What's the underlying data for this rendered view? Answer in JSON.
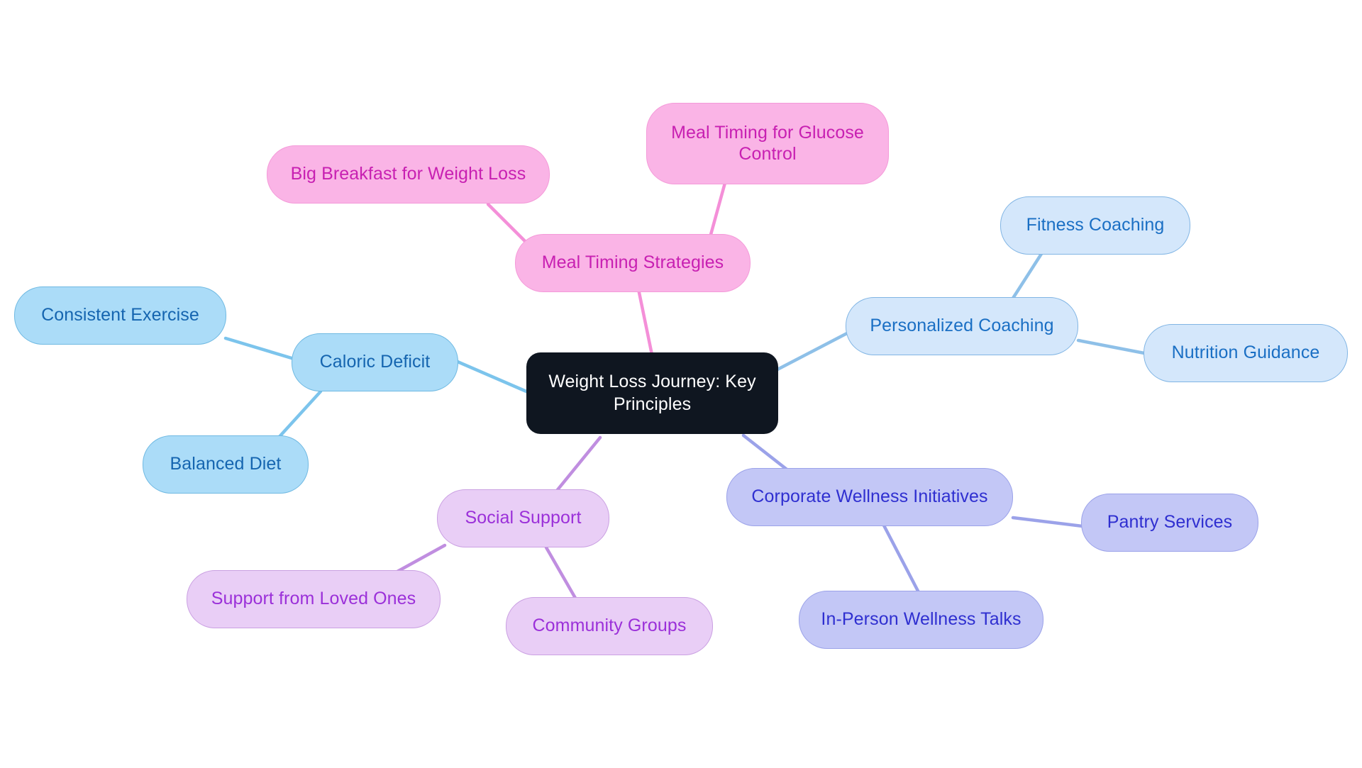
{
  "diagram": {
    "type": "mindmap",
    "background": "#ffffff",
    "root": {
      "id": "root",
      "label": "Weight Loss Journey: Key\nPrinciples",
      "fill": "#0f1620",
      "text_color": "#ffffff"
    },
    "palette": {
      "blue_fill": "#abdcf8",
      "blue_border": "#6fb9e2",
      "blue_text": "#1565b0",
      "paleblue_fill": "#d4e7fb",
      "paleblue_border": "#81b5e4",
      "paleblue_text": "#1a6fc4",
      "pink_fill": "#fab4e6",
      "pink_border": "#f49ad9",
      "pink_text": "#c820b2",
      "violet_fill": "#e9cef6",
      "violet_border": "#caa0e2",
      "violet_text": "#9b30d9",
      "periwinkle_fill": "#c3c7f6",
      "periwinkle_border": "#9ba2e9",
      "periwinkle_text": "#2f2fd0"
    },
    "branches": [
      {
        "id": "caloric-deficit",
        "label": "Caloric Deficit",
        "color_key": "blue",
        "children": [
          {
            "id": "consistent-exercise",
            "label": "Consistent Exercise"
          },
          {
            "id": "balanced-diet",
            "label": "Balanced Diet"
          }
        ]
      },
      {
        "id": "meal-timing-strategies",
        "label": "Meal Timing Strategies",
        "color_key": "pink",
        "children": [
          {
            "id": "big-breakfast-for-weight-loss",
            "label": "Big Breakfast for Weight Loss"
          },
          {
            "id": "meal-timing-for-glucose-control",
            "label": "Meal Timing for Glucose\nControl"
          }
        ]
      },
      {
        "id": "personalized-coaching",
        "label": "Personalized Coaching",
        "color_key": "paleblue",
        "children": [
          {
            "id": "fitness-coaching",
            "label": "Fitness Coaching"
          },
          {
            "id": "nutrition-guidance",
            "label": "Nutrition Guidance"
          }
        ]
      },
      {
        "id": "corporate-wellness-initiatives",
        "label": "Corporate Wellness Initiatives",
        "color_key": "periwinkle",
        "children": [
          {
            "id": "pantry-services",
            "label": "Pantry Services"
          },
          {
            "id": "in-person-wellness-talks",
            "label": "In-Person Wellness Talks"
          }
        ]
      },
      {
        "id": "social-support",
        "label": "Social Support",
        "color_key": "violet",
        "children": [
          {
            "id": "support-from-loved-ones",
            "label": "Support from Loved Ones"
          },
          {
            "id": "community-groups",
            "label": "Community Groups"
          }
        ]
      }
    ],
    "nodes": {
      "root": {
        "label": "Weight Loss Journey: Key\nPrinciples"
      },
      "caloric_deficit": {
        "label": "Caloric Deficit"
      },
      "consistent_exercise": {
        "label": "Consistent Exercise"
      },
      "balanced_diet": {
        "label": "Balanced Diet"
      },
      "meal_timing_strategies": {
        "label": "Meal Timing Strategies"
      },
      "big_breakfast": {
        "label": "Big Breakfast for Weight Loss"
      },
      "meal_timing_glucose": {
        "label": "Meal Timing for Glucose\nControl"
      },
      "personalized_coaching": {
        "label": "Personalized Coaching"
      },
      "fitness_coaching": {
        "label": "Fitness Coaching"
      },
      "nutrition_guidance": {
        "label": "Nutrition Guidance"
      },
      "corporate_wellness": {
        "label": "Corporate Wellness Initiatives"
      },
      "pantry_services": {
        "label": "Pantry Services"
      },
      "in_person_wellness_talks": {
        "label": "In-Person Wellness Talks"
      },
      "social_support": {
        "label": "Social Support"
      },
      "support_from_loved_ones": {
        "label": "Support from Loved Ones"
      },
      "community_groups": {
        "label": "Community Groups"
      }
    }
  }
}
